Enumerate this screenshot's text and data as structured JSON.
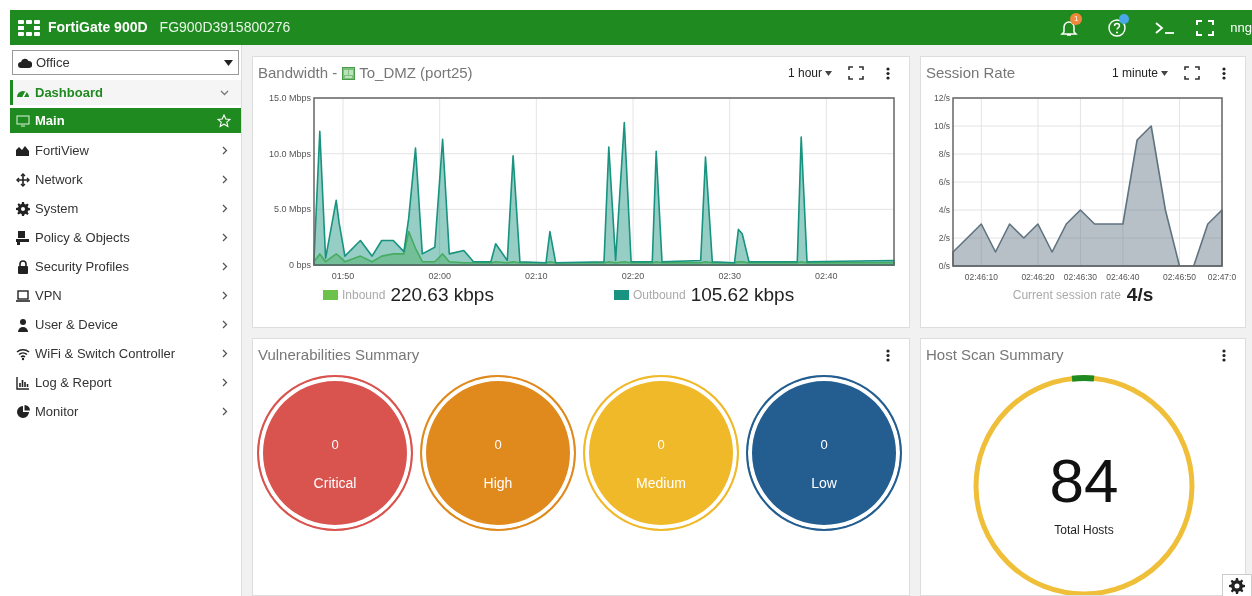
{
  "header": {
    "product": "FortiGate 900D",
    "serial": "FG900D3915800276",
    "notification_count": "1",
    "user": "nng"
  },
  "sidebar": {
    "vdom": "Office",
    "items": [
      {
        "label": "Dashboard",
        "selected": true,
        "expanded": true,
        "children": [
          {
            "label": "Main",
            "selected": true,
            "starred": false
          }
        ]
      },
      {
        "label": "FortiView",
        "selected": false,
        "expanded": false
      },
      {
        "label": "Network",
        "selected": false,
        "expanded": false
      },
      {
        "label": "System",
        "selected": false,
        "expanded": false
      },
      {
        "label": "Policy & Objects",
        "selected": false,
        "expanded": false
      },
      {
        "label": "Security Profiles",
        "selected": false,
        "expanded": false
      },
      {
        "label": "VPN",
        "selected": false,
        "expanded": false
      },
      {
        "label": "User & Device",
        "selected": false,
        "expanded": false
      },
      {
        "label": "WiFi & Switch Controller",
        "selected": false,
        "expanded": false
      },
      {
        "label": "Log & Report",
        "selected": false,
        "expanded": false
      },
      {
        "label": "Monitor",
        "selected": false,
        "expanded": false
      }
    ]
  },
  "bandwidth": {
    "title": "Bandwidth -",
    "interface": "To_DMZ (port25)",
    "range": "1 hour",
    "readings": [
      "220.63 kbps",
      "105.62 kbps"
    ],
    "chart_data": {
      "type": "area",
      "grid": true,
      "x": [
        107,
        107.6,
        108.2,
        109.3,
        109.6,
        110.2,
        111.8,
        113,
        114,
        115.2,
        116.3,
        116.8,
        117.5,
        118.2,
        119.5,
        120.3,
        121,
        122.5,
        123.5,
        125.3,
        125.8,
        127,
        127.6,
        128.3,
        131,
        131.4,
        132,
        137,
        137.5,
        138.2,
        139.1,
        139.8,
        142,
        142.4,
        143,
        147,
        147.5,
        148.2,
        150.5,
        150.9,
        151.3,
        152,
        157,
        157.4,
        158,
        167
      ],
      "series": [
        {
          "name": "Inbound",
          "color": "#6cc24a",
          "values": [
            0.3,
            1,
            0.3,
            1,
            0.8,
            0.3,
            0.8,
            0.3,
            0.8,
            1,
            1,
            3,
            1.5,
            0.3,
            0.3,
            1,
            0.3,
            0.2,
            0.2,
            0.2,
            0.3,
            0.2,
            0.3,
            0.2,
            0.2,
            0.3,
            0.2,
            0.2,
            0.3,
            0.2,
            0.3,
            0.2,
            0.2,
            0.3,
            0.2,
            0.2,
            0.3,
            0.2,
            0.2,
            0.3,
            0.3,
            0.2,
            0.2,
            0.3,
            0.2,
            0.2
          ]
        },
        {
          "name": "Outbound",
          "color": "#17937f",
          "values": [
            0.5,
            12,
            0.6,
            5.8,
            3.8,
            0.8,
            2.2,
            0.8,
            2.2,
            2.2,
            1.2,
            4.2,
            10.5,
            1,
            1.6,
            11.3,
            1,
            1.3,
            0.3,
            0.3,
            1.9,
            0.4,
            9.8,
            0.3,
            0.2,
            3,
            0.2,
            0.3,
            10.6,
            0.4,
            12.8,
            0.3,
            0.3,
            10.2,
            0.3,
            0.4,
            9.7,
            0.3,
            0.2,
            3.2,
            2.8,
            0.3,
            0.3,
            11.5,
            0.3,
            0.4
          ]
        }
      ],
      "xlim": [
        107,
        167
      ],
      "ylim": [
        0,
        15
      ],
      "xticks": [
        {
          "value": 110,
          "label": "01:50"
        },
        {
          "value": 120,
          "label": "02:00"
        },
        {
          "value": 130,
          "label": "02:10"
        },
        {
          "value": 140,
          "label": "02:20"
        },
        {
          "value": 150,
          "label": "02:30"
        },
        {
          "value": 160,
          "label": "02:40"
        }
      ],
      "yticks": [
        {
          "value": 0,
          "label": "0 bps"
        },
        {
          "value": 5,
          "label": "5.0 Mbps"
        },
        {
          "value": 10,
          "label": "10.0 Mbps"
        },
        {
          "value": 15,
          "label": "15.0 Mbps"
        }
      ]
    }
  },
  "session_rate": {
    "title": "Session Rate",
    "range": "1 minute",
    "caption": "Current session rate",
    "reading": "4/s",
    "chart_data": {
      "type": "area",
      "grid": true,
      "categories": [
        null,
        null,
        "02:46:10",
        null,
        null,
        null,
        "02:46:20",
        null,
        null,
        "02:46:30",
        null,
        null,
        "02:46:40",
        null,
        null,
        null,
        "02:46:50",
        null,
        null,
        "02:47:0"
      ],
      "series": [
        {
          "color": "#5f7380",
          "values": [
            1,
            2,
            3,
            1,
            3,
            2,
            3,
            1,
            3,
            4,
            3,
            3,
            3,
            9,
            10,
            4,
            0,
            0,
            3,
            4
          ]
        }
      ],
      "ylim": [
        0,
        12
      ],
      "yticks": [
        {
          "value": 0,
          "label": "0/s"
        },
        {
          "value": 2,
          "label": "2/s"
        },
        {
          "value": 4,
          "label": "4/s"
        },
        {
          "value": 6,
          "label": "6/s"
        },
        {
          "value": 8,
          "label": "8/s"
        },
        {
          "value": 10,
          "label": "10/s"
        },
        {
          "value": 12,
          "label": "12/s"
        }
      ]
    }
  },
  "vulnerabilities": {
    "title": "Vulnerabilities Summary",
    "items": [
      {
        "count": "0",
        "label": "Critical",
        "color": "#d9534f"
      },
      {
        "count": "0",
        "label": "High",
        "color": "#e08a1e"
      },
      {
        "count": "0",
        "label": "Medium",
        "color": "#f0b92a"
      },
      {
        "count": "0",
        "label": "Low",
        "color": "#245e91"
      }
    ]
  },
  "host_scan": {
    "title": "Host Scan Summary",
    "total": "84",
    "caption": "Total Hosts"
  }
}
